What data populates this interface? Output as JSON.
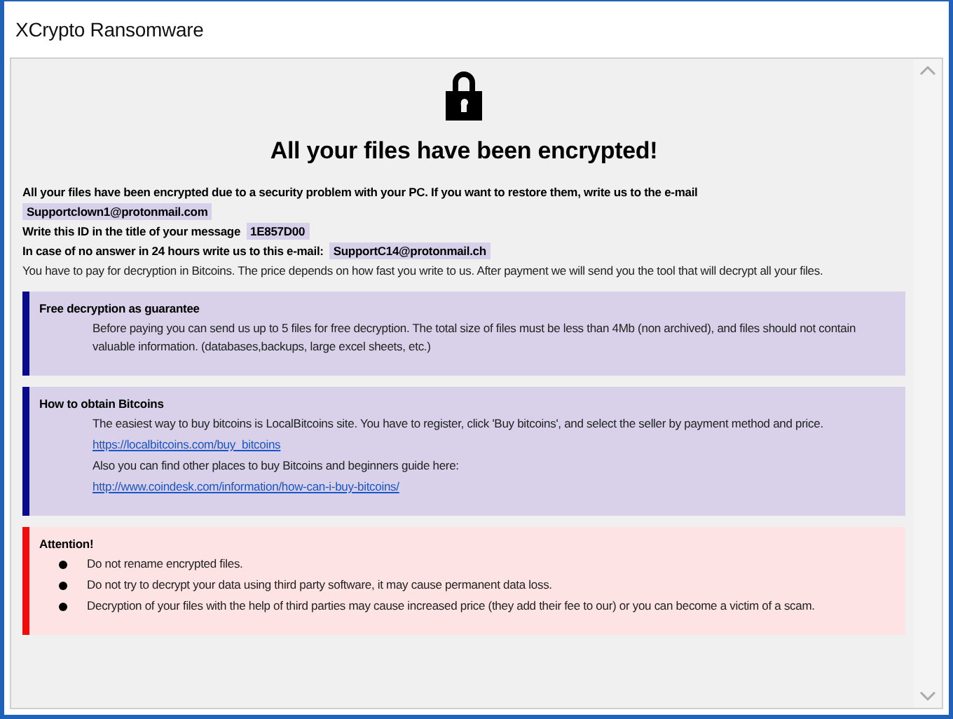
{
  "window": {
    "title": "XCrypto Ransomware"
  },
  "heading": "All your files have been encrypted!",
  "intro": [
    {
      "segments": [
        {
          "kind": "bold",
          "text": "All your files have been encrypted due to a security problem with your PC. If you want to restore them, write us to the e-mail"
        }
      ]
    },
    {
      "segments": [
        {
          "kind": "highlight",
          "text": "Supportclown1@protonmail.com"
        }
      ]
    },
    {
      "segments": [
        {
          "kind": "bold",
          "text": "Write this ID in the title of your message"
        },
        {
          "kind": "highlight",
          "text": "1E857D00"
        }
      ]
    },
    {
      "segments": [
        {
          "kind": "bold",
          "text": "In case of no answer in 24 hours write us to this e-mail:"
        },
        {
          "kind": "highlight",
          "text": "SupportC14@protonmail.ch"
        }
      ]
    },
    {
      "segments": [
        {
          "kind": "plain",
          "text": "You have to pay for decryption in Bitcoins. The price depends on how fast you write to us. After payment we will send you the tool that will decrypt all your files."
        }
      ]
    }
  ],
  "sections": [
    {
      "kind": "info",
      "title": "Free decryption as guarantee",
      "items": [
        {
          "kind": "text",
          "text": "Before paying you can send us up to 5 files for free decryption. The total size of files must be less than 4Mb (non archived), and files should not contain valuable information. (databases,backups, large excel sheets, etc.)"
        }
      ]
    },
    {
      "kind": "info",
      "title": "How to obtain Bitcoins",
      "items": [
        {
          "kind": "text",
          "text": "The easiest way to buy bitcoins is LocalBitcoins site. You have to register, click 'Buy bitcoins', and select the seller by payment method and price."
        },
        {
          "kind": "link",
          "text": "https://localbitcoins.com/buy_bitcoins"
        },
        {
          "kind": "text",
          "text": "Also you can find other places to buy Bitcoins and beginners guide here:"
        },
        {
          "kind": "link",
          "text": "http://www.coindesk.com/information/how-can-i-buy-bitcoins/"
        }
      ]
    },
    {
      "kind": "warning",
      "title": "Attention!",
      "items": [
        {
          "kind": "bullet",
          "text": "Do not rename encrypted files."
        },
        {
          "kind": "bullet",
          "text": "Do not try to decrypt your data using third party software, it may cause permanent data loss."
        },
        {
          "kind": "bullet",
          "text": "Decryption of your files with the help of third parties may cause increased price (they add their fee to our) or you can become a victim of a scam."
        }
      ]
    }
  ]
}
